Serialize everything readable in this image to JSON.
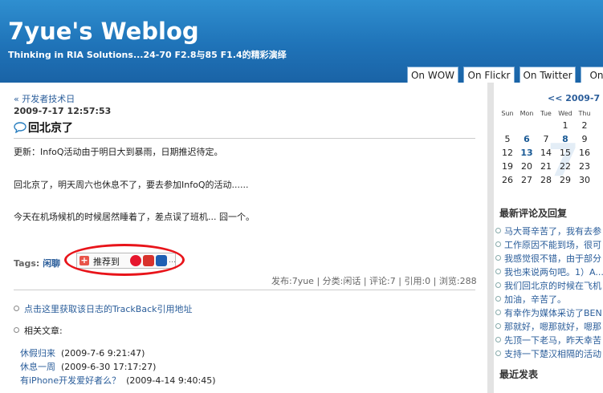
{
  "header": {
    "title": "7yue's Weblog",
    "subtitle": "Thinking in RIA Solutions...24-70 F2.8与85 F1.4的精彩演绎",
    "tabs": [
      "On WOW",
      "On Flickr",
      "On Twitter",
      "On"
    ]
  },
  "post": {
    "back_link": "« 开发者技术日",
    "datetime": "2009-7-17 12:57:53",
    "title": "回北京了",
    "paragraphs": [
      "更新：InfoQ活动由于明日大到暴雨，日期推迟待定。",
      "回北京了，明天周六也休息不了，要去参加InfoQ的活动......",
      "今天在机场候机的时候居然睡着了，差点误了班机... 囧一个。"
    ],
    "tags_label": "Tags:",
    "tag": "闲聊",
    "share_label": "推荐到",
    "meta": "发布:7yue | 分类:闲话 | 评论:7 | 引用:0 | 浏览:288",
    "trackback": "点击这里获取该日志的TrackBack引用地址",
    "related_title": "相关文章:",
    "related": [
      {
        "title": "休假归来",
        "date": "(2009-7-6 9:21:47)"
      },
      {
        "title": "休息一周",
        "date": "(2009-6-30 17:17:27)"
      },
      {
        "title": "有iPhone开发爱好者么？",
        "date": "(2009-4-14 9:40:45)"
      }
    ]
  },
  "calendar": {
    "header": "<< 2009-7 >>",
    "days": [
      "Sun",
      "Mon",
      "Tue",
      "Wed",
      "Thu"
    ],
    "rows": [
      [
        "",
        "",
        "",
        "1",
        "2"
      ],
      [
        "5",
        "6",
        "7",
        "8",
        "9"
      ],
      [
        "12",
        "13",
        "14",
        "15",
        "16"
      ],
      [
        "19",
        "20",
        "21",
        "22",
        "23"
      ],
      [
        "26",
        "27",
        "28",
        "29",
        "30"
      ]
    ],
    "highlighted": [
      "6",
      "8",
      "13"
    ],
    "watermark": "7"
  },
  "sidebar": {
    "recent_comments_title": "最新评论及回复",
    "comments": [
      "马大哥辛苦了，我有去参",
      "工作原因不能到场，很可",
      "我感觉很不错，由于部分",
      "我也来说两句吧。1）A...",
      "我们回北京的时候在飞机",
      "加油，辛苦了。",
      "有幸作为媒体采访了BEN",
      "那就好，嗯那就好，嗯那",
      "先顶一下老马，昨天幸苦",
      "支持一下楚汉相隔的活动"
    ],
    "recent_posts_title": "最近发表"
  }
}
